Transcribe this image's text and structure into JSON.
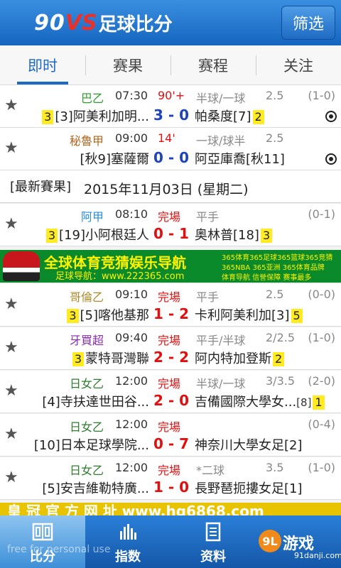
{
  "header": {
    "logo_num": "90",
    "logo_vs": "VS",
    "logo_cn": "足球比分",
    "filter_label": "筛选"
  },
  "tabs": [
    {
      "label": "即时",
      "active": true
    },
    {
      "label": "赛果",
      "active": false
    },
    {
      "label": "赛程",
      "active": false
    },
    {
      "label": "关注",
      "active": false
    }
  ],
  "live_matches": [
    {
      "league": "巴乙",
      "league_color": "#2e9b2e",
      "time": "07:30",
      "status": "90'+",
      "status_color": "#e01010",
      "handicap": "半球/一球",
      "line": "2.5",
      "ht": "(1-0)",
      "home_badge": "3",
      "home": "[3]阿美利加明...",
      "score": "3 - 0",
      "away": "帕桑度[7]",
      "away_badge": "2",
      "ball_icon": "soccer-ball-icon"
    },
    {
      "league": "秘魯甲",
      "league_color": "#b5651d",
      "time": "09:00",
      "status": "14'",
      "status_color": "#e01010",
      "handicap": "一球/球半",
      "line": "2.5",
      "ht": "",
      "home_badge": "",
      "home": "[秋9]塞薩爾",
      "score": "0 - 0",
      "away": "阿亞庫喬[秋11]",
      "away_badge": "",
      "ball_icon": "soccer-ball-icon"
    }
  ],
  "results_section": {
    "tag": "[最新賽果]",
    "date": "2015年11月03日 (星期二)"
  },
  "ad": {
    "title": "全球体育竞猜娱乐导航",
    "url": "足球导航：www.222365.com",
    "side_1": "365体育365足球365篮球365竞猜",
    "side_2": "365NBA 365亚洲 365体育品牌",
    "side_3": "体育导航  信誉保障  赛事最多"
  },
  "finished_matches": [
    {
      "league": "阿甲",
      "league_color": "#2a8bd8",
      "time": "08:10",
      "status": "完場",
      "handicap": "平手",
      "line": "",
      "ht": "(0-1)",
      "home_badge": "3",
      "home": "[19]小阿根廷人",
      "score": "0 - 1",
      "away": "奥林普[18]",
      "away_badge": "3"
    },
    {
      "league": "哥倫乙",
      "league_color": "#b08a2a",
      "time": "09:10",
      "status": "完場",
      "handicap": "平手",
      "line": "2.5",
      "ht": "(0-0)",
      "home_badge": "3",
      "home": "[5]喀他基那",
      "score": "1 - 2",
      "away": "卡利阿美利加[3]",
      "away_badge": "5"
    },
    {
      "league": "牙買超",
      "league_color": "#8a2ab0",
      "time": "09:40",
      "status": "完場",
      "handicap": "平手/半球",
      "line": "2/2.5",
      "ht": "(1-0)",
      "home_badge": "3",
      "home": "蒙特哥灣聯",
      "score": "2 - 2",
      "away": "阿内特加登斯",
      "away_badge": "2"
    },
    {
      "league": "日女乙",
      "league_color": "#2e7d2e",
      "time": "12:00",
      "status": "完場",
      "handicap": "半球/一球",
      "line": "3/3.5",
      "ht": "(2-0)",
      "home_badge": "",
      "home": "[4]寺扶達世田谷...",
      "score": "2 - 0",
      "away": "吉備國際大學女...",
      "away_rank": "[8]",
      "away_badge": "1"
    },
    {
      "league": "日女乙",
      "league_color": "#2e7d2e",
      "time": "12:00",
      "status": "完場",
      "handicap": "",
      "line": "",
      "ht": "(0-4)",
      "home_badge": "",
      "home": "[10]日本足球學院...",
      "score": "0 - 7",
      "away": "神奈川大學女足[2]",
      "away_badge": ""
    },
    {
      "league": "日女乙",
      "league_color": "#2e7d2e",
      "time": "12:00",
      "status": "完場",
      "handicap": "*二球",
      "line": "3.5",
      "ht": "(1-0)",
      "home_badge": "",
      "home": "[5]安吉維勒特廣...",
      "score": "1 - 0",
      "away": "長野琶扼摟女足[1]",
      "away_badge": ""
    }
  ],
  "bottom_ad_text": "皇 冠 官 方 网 址   www.hg6868.com",
  "bottom_nav": [
    {
      "label": "比分",
      "icon": "scoreboard-icon",
      "active": true
    },
    {
      "label": "指数",
      "icon": "bar-chart-icon",
      "active": false
    },
    {
      "label": "资料",
      "icon": "document-icon",
      "active": false
    }
  ],
  "watermark": "free for personal use",
  "brand": {
    "logo": "9L",
    "name": "游戏",
    "url": "91danji.com"
  }
}
